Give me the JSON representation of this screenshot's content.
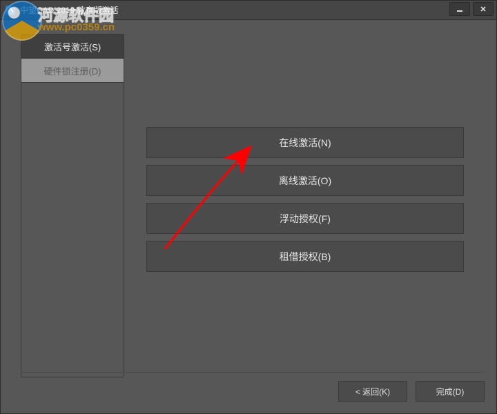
{
  "window": {
    "title": "中望CAD 2019 教育版激活"
  },
  "sidebar": {
    "tabs": [
      {
        "label": "激活号激活(S)"
      },
      {
        "label": "硬件锁注册(D)"
      }
    ]
  },
  "options": [
    {
      "label": "在线激活(N)"
    },
    {
      "label": "离线激活(O)"
    },
    {
      "label": "浮动授权(F)"
    },
    {
      "label": "租借授权(B)"
    }
  ],
  "footer": {
    "back": "< 返回(K)",
    "finish": "完成(D)"
  },
  "watermark": {
    "line1": "河源软件园",
    "line2": "www.pc0359.cn"
  }
}
